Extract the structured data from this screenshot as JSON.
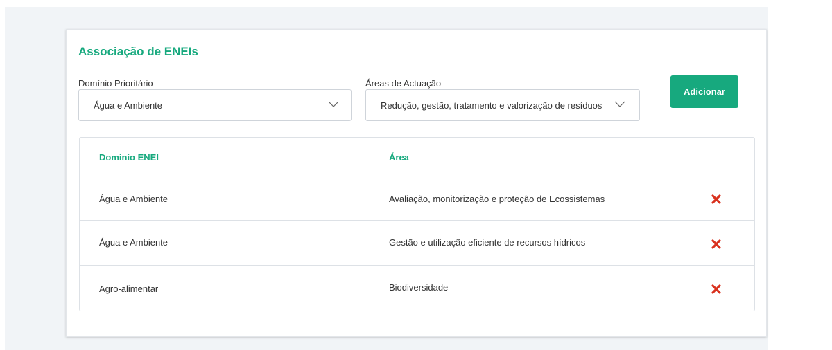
{
  "card": {
    "title": "Associação de ENEIs"
  },
  "form": {
    "dominio_label": "Domínio Prioritário",
    "dominio_value": "Água e Ambiente",
    "areas_label": "Áreas de Actuação",
    "areas_value": "Redução, gestão, tratamento e valorização de resíduos",
    "add_button": "Adicionar"
  },
  "table": {
    "headers": [
      "Dominio ENEI",
      "Área"
    ],
    "rows": [
      {
        "dominio": "Água e Ambiente",
        "area": "Avaliação, monitorização e proteção de Ecossistemas",
        "action_icon": "delete-x-icon"
      },
      {
        "dominio": "Água e Ambiente",
        "area": "Gestão e utilização eficiente de recursos hídricos",
        "action_icon": "delete-x-icon"
      },
      {
        "dominio": "Agro-alimentar",
        "area": "Biodiversidade",
        "action_icon": "delete-x-icon"
      }
    ]
  },
  "colors": {
    "accent": "#17a97e",
    "delete": "#d9311e",
    "background": "#f1f4f7"
  }
}
